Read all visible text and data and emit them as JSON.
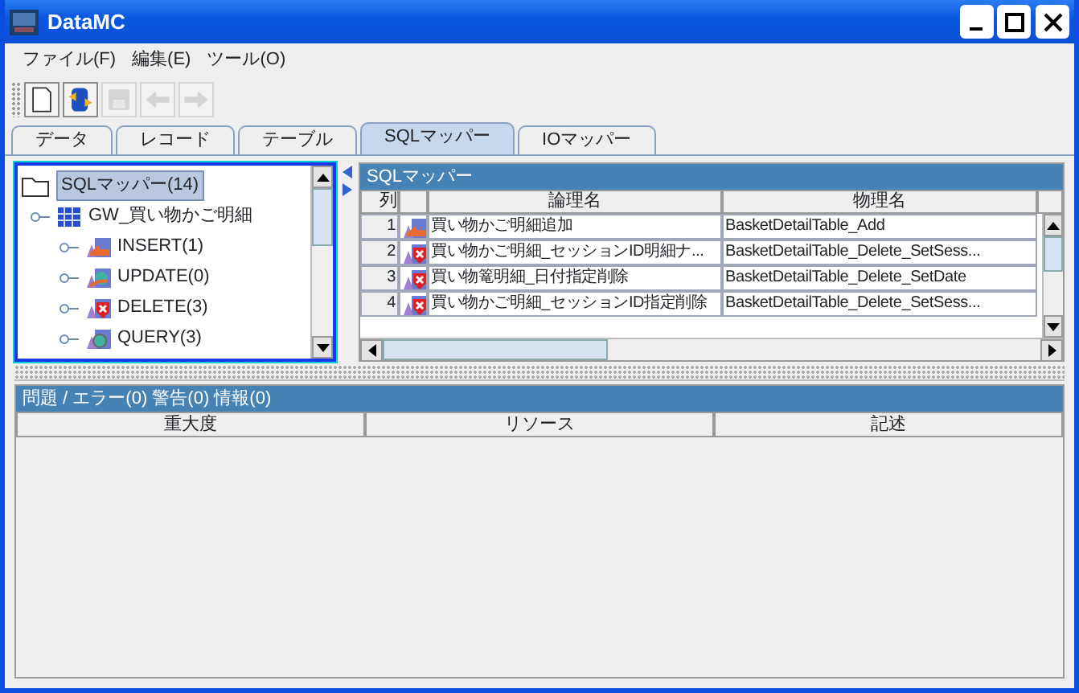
{
  "window": {
    "title": "DataMC"
  },
  "menu": [
    {
      "label": "ファイル(F)"
    },
    {
      "label": "編集(E)"
    },
    {
      "label": "ツール(O)"
    }
  ],
  "toolbar": [
    {
      "kind": "new",
      "disabled": false
    },
    {
      "kind": "sync",
      "disabled": false
    },
    {
      "kind": "save",
      "disabled": true
    },
    {
      "kind": "back",
      "disabled": true
    },
    {
      "kind": "forward",
      "disabled": true
    }
  ],
  "tabs": [
    {
      "label": "データ",
      "selected": false
    },
    {
      "label": "レコード",
      "selected": false
    },
    {
      "label": "テーブル",
      "selected": false
    },
    {
      "label": "SQLマッパー",
      "selected": true
    },
    {
      "label": "IOマッパー",
      "selected": false
    }
  ],
  "tree": {
    "label": "SQLマッパー(14)",
    "selected": true,
    "children": [
      {
        "label": "GW_買い物かご明細",
        "kind": "table",
        "children": [
          {
            "label": "INSERT(1)",
            "kind": "insert"
          },
          {
            "label": "UPDATE(0)",
            "kind": "update"
          },
          {
            "label": "DELETE(3)",
            "kind": "delete"
          },
          {
            "label": "QUERY(3)",
            "kind": "query"
          }
        ]
      }
    ]
  },
  "sql_panel": {
    "title": "SQLマッパー",
    "columns": [
      "列",
      "論理名",
      "物理名"
    ],
    "rows": [
      {
        "number": "1",
        "kind": "insert",
        "logical": "買い物かご明細追加",
        "physical": "BasketDetailTable_Add"
      },
      {
        "number": "2",
        "kind": "delete",
        "logical": "買い物かご明細_セッションID明細ナ...",
        "physical": "BasketDetailTable_Delete_SetSess..."
      },
      {
        "number": "3",
        "kind": "delete",
        "logical": "買い物篭明細_日付指定削除",
        "physical": "BasketDetailTable_Delete_SetDate"
      },
      {
        "number": "4",
        "kind": "delete",
        "logical": "買い物かご明細_セッションID指定削除",
        "physical": "BasketDetailTable_Delete_SetSess..."
      }
    ]
  },
  "problems": {
    "title": "問題 / エラー(0) 警告(0) 情報(0)",
    "columns": [
      "重大度",
      "リソース",
      "記述"
    ]
  }
}
